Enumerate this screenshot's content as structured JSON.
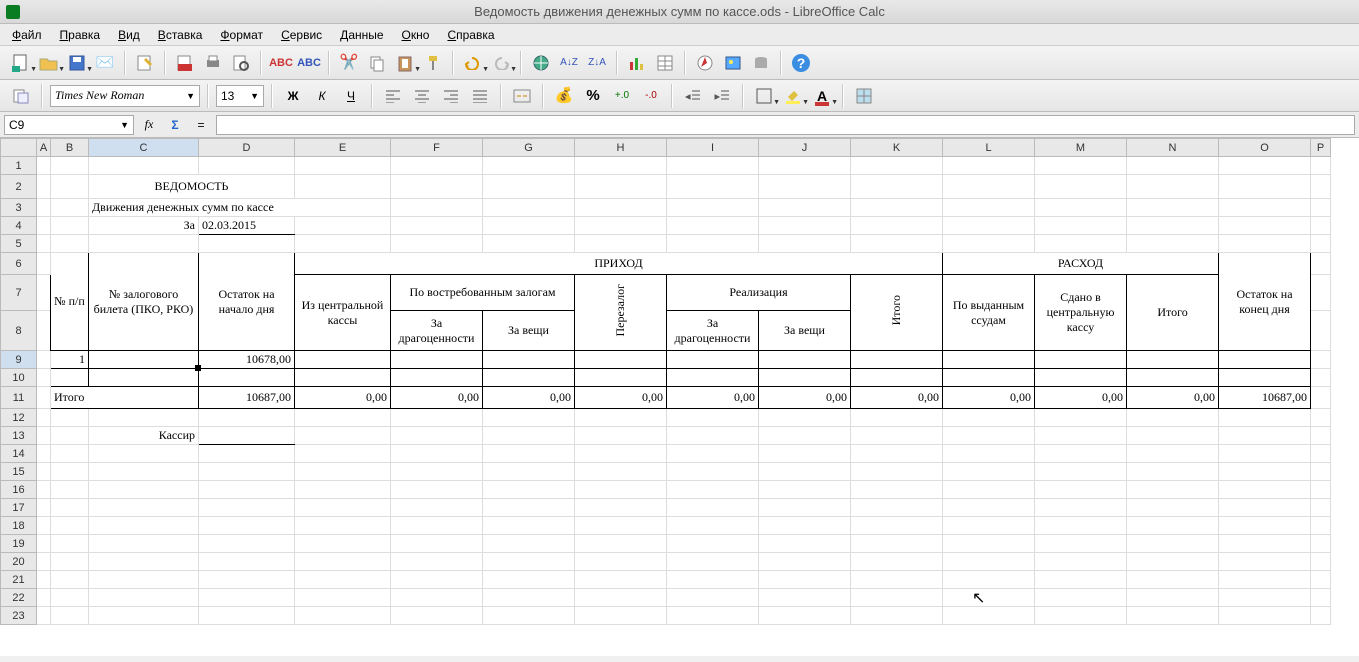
{
  "title": "Ведомость движения денежных сумм по кассе.ods - LibreOffice Calc",
  "menus": [
    "Файл",
    "Правка",
    "Вид",
    "Вставка",
    "Формат",
    "Сервис",
    "Данные",
    "Окно",
    "Справка"
  ],
  "font_name": "Times New Roman",
  "font_size": "13",
  "style_bold": "Ж",
  "style_italic": "К",
  "style_underline": "Ч",
  "cell_ref": "C9",
  "fx": "fx",
  "sigma": "Σ",
  "eq": "=",
  "cols": [
    "A",
    "B",
    "C",
    "D",
    "E",
    "F",
    "G",
    "H",
    "I",
    "J",
    "K",
    "L",
    "M",
    "N",
    "O",
    "P"
  ],
  "rows": [
    "1",
    "2",
    "3",
    "4",
    "5",
    "6",
    "7",
    "8",
    "9",
    "10",
    "11",
    "12",
    "13",
    "14",
    "15",
    "16",
    "17",
    "18",
    "19",
    "20",
    "21",
    "22",
    "23"
  ],
  "sheet": {
    "title": "ВЕДОМОСТЬ",
    "subtitle": "Движения денежных сумм по кассе",
    "za": "За",
    "date": "02.03.2015",
    "h_npp": "№ п/п",
    "h_ticket": "№ залогового билета (ПКО, РКО)",
    "h_ost_begin": "Остаток на начало дня",
    "h_income": "ПРИХОД",
    "h_from_central": "Из центральной кассы",
    "h_by_demand": "По востребованным залогам",
    "h_for_valuables": "За драгоценности",
    "h_for_things": "За вещи",
    "h_perezalog": "Перезалог",
    "h_realisation": "Реализация",
    "h_itogo": "Итого",
    "h_expense": "РАСХОД",
    "h_by_loans": "По выданным ссудам",
    "h_to_central": "Сдано в центральную кассу",
    "h_ost_end": "Остаток на конец дня",
    "row_num": "1",
    "row_balance": "10678,00",
    "total_label": "Итого",
    "total_start": "10687,00",
    "zero": "0,00",
    "total_end": "10687,00",
    "cashier": "Кассир"
  }
}
